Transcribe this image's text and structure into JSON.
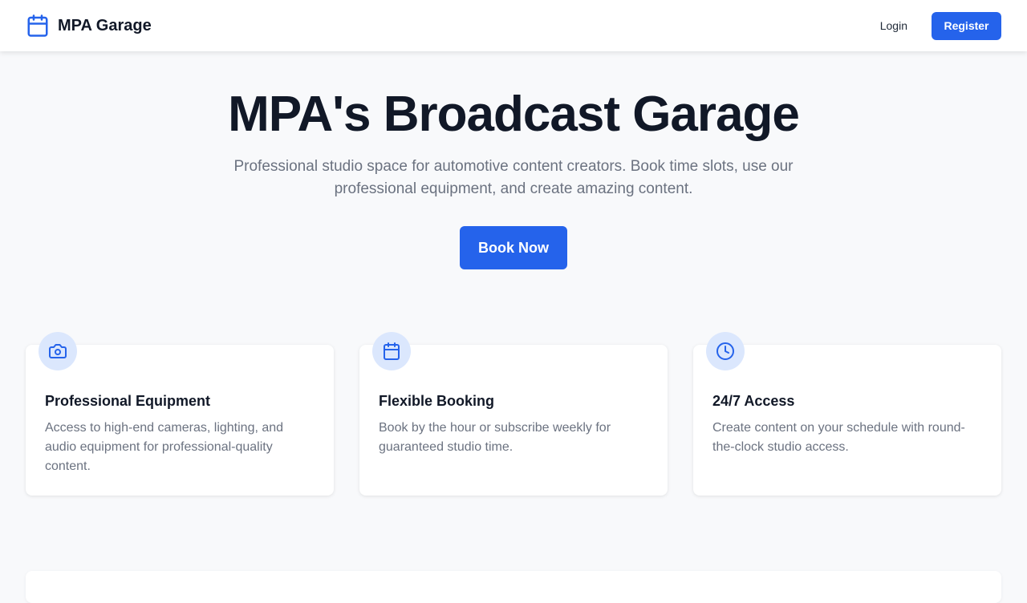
{
  "navbar": {
    "brand_name": "MPA Garage",
    "brand_icon": "calendar-icon",
    "login_label": "Login",
    "register_label": "Register"
  },
  "hero": {
    "title": "MPA's Broadcast Garage",
    "subtitle": "Professional studio space for automotive content creators. Book time slots, use our professional equipment, and create amazing content.",
    "cta_label": "Book Now"
  },
  "features": [
    {
      "icon": "camera-icon",
      "title": "Professional Equipment",
      "description": "Access to high-end cameras, lighting, and audio equipment for professional-quality content."
    },
    {
      "icon": "calendar-icon",
      "title": "Flexible Booking",
      "description": "Book by the hour or subscribe weekly for guaranteed studio time."
    },
    {
      "icon": "clock-icon",
      "title": "24/7 Access",
      "description": "Create content on your schedule with round-the-clock studio access."
    }
  ],
  "colors": {
    "primary": "#2563eb",
    "heading": "#111827",
    "muted": "#6b7280",
    "icon_bg": "#dbe7fd",
    "page_bg": "#f8f9fb"
  }
}
